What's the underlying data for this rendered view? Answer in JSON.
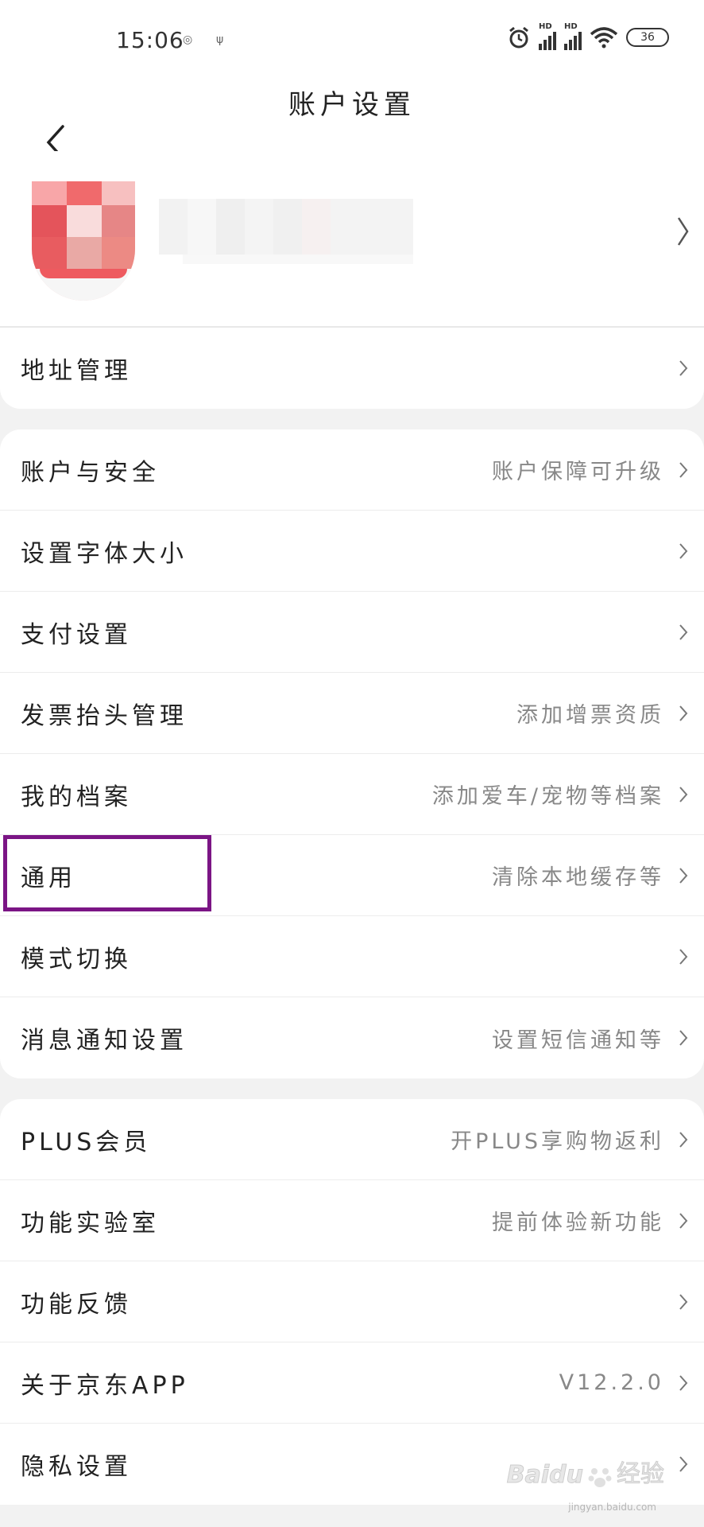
{
  "status_bar": {
    "time": "15:06",
    "battery": "36",
    "signal_badge": "HD"
  },
  "header": {
    "title": "账户设置"
  },
  "profile": {
    "blurred": true
  },
  "groups": [
    {
      "items": [
        {
          "label": "地址管理",
          "value": ""
        }
      ]
    },
    {
      "items": [
        {
          "label": "账户与安全",
          "value": "账户保障可升级"
        },
        {
          "label": "设置字体大小",
          "value": ""
        },
        {
          "label": "支付设置",
          "value": ""
        },
        {
          "label": "发票抬头管理",
          "value": "添加增票资质"
        },
        {
          "label": "我的档案",
          "value": "添加爱车/宠物等档案"
        },
        {
          "label": "通用",
          "value": "清除本地缓存等"
        },
        {
          "label": "模式切换",
          "value": ""
        },
        {
          "label": "消息通知设置",
          "value": "设置短信通知等"
        }
      ]
    },
    {
      "items": [
        {
          "label": "PLUS会员",
          "value": "开PLUS享购物返利"
        },
        {
          "label": "功能实验室",
          "value": "提前体验新功能"
        },
        {
          "label": "功能反馈",
          "value": ""
        },
        {
          "label": "关于京东APP",
          "value": "V12.2.0"
        },
        {
          "label": "隐私设置",
          "value": ""
        }
      ]
    }
  ],
  "watermark": {
    "brand": "Baidu",
    "suffix": "经验",
    "url": "jingyan.baidu.com"
  },
  "colors": {
    "highlight_border": "#7b1585",
    "page_bg": "#f2f2f2",
    "value_text": "#888888"
  }
}
